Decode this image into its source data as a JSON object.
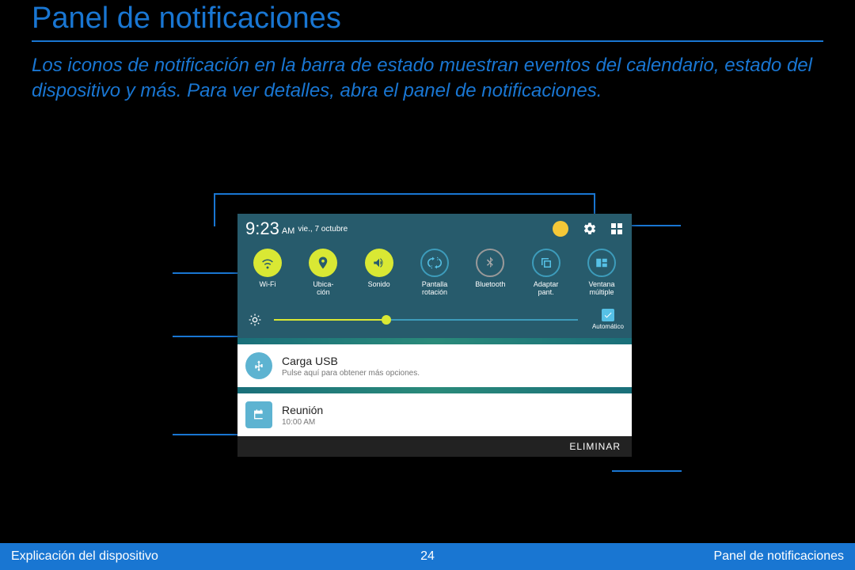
{
  "page": {
    "title": "Panel de notificaciones",
    "intro": "Los iconos de notificación en la barra de estado muestran eventos del calendario, estado del dispositivo y más. Para ver detalles, abra el panel de notificaciones."
  },
  "footer": {
    "left": "Explicación del dispositivo",
    "page_num": "24",
    "right": "Panel de notificaciones"
  },
  "panel": {
    "time": "9:23",
    "ampm": "AM",
    "date": "vie., 7 octubre",
    "toggles": [
      {
        "label": "Wi-Fi",
        "on": true
      },
      {
        "label_line1": "Ubica-",
        "label_line2": "ción",
        "on": true
      },
      {
        "label": "Sonido",
        "on": true
      },
      {
        "label_line1": "Pantalla",
        "label_line2": "rotación",
        "on": false
      },
      {
        "label": "Bluetooth",
        "on": false
      },
      {
        "label_line1": "Adaptar",
        "label_line2": "pant.",
        "on": false
      },
      {
        "label_line1": "Ventana",
        "label_line2": "múltiple",
        "on": false
      }
    ],
    "auto_label": "Automático",
    "notifications": [
      {
        "title": "Carga USB",
        "sub": "Pulse aquí para obtener más opciones.",
        "icon": "usb"
      },
      {
        "title": "Reunión",
        "sub": "10:00 AM",
        "icon": "calendar"
      }
    ],
    "clear": "ELIMINAR"
  }
}
